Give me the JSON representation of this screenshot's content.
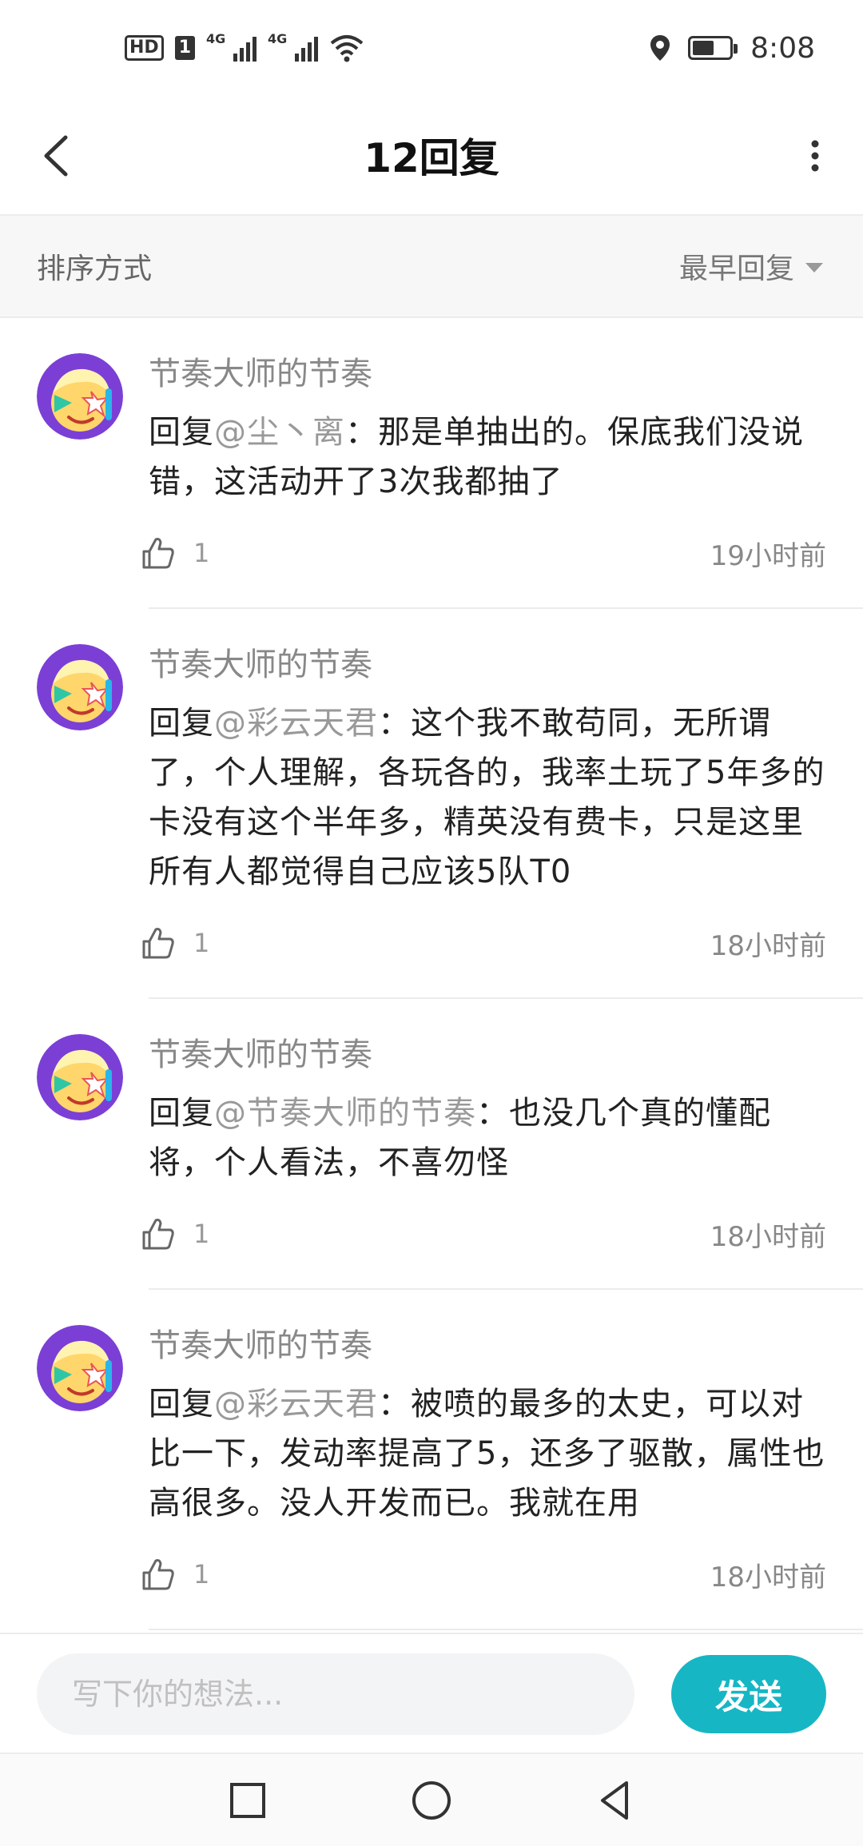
{
  "status_bar": {
    "hd": "HD",
    "sim": "1",
    "net1": "4G",
    "net2": "4G",
    "time": "8:08"
  },
  "header": {
    "title": "12回复"
  },
  "sort_bar": {
    "label": "排序方式",
    "selected": "最早回复"
  },
  "replies": [
    {
      "author": "节奏大师的节奏",
      "prefix": "回复",
      "mention": "@尘丶离",
      "text": "：那是单抽出的。保底我们没说错，这活动开了3次我都抽了",
      "likes": "1",
      "time": "19小时前"
    },
    {
      "author": "节奏大师的节奏",
      "prefix": "回复",
      "mention": "@彩云天君",
      "text": "：这个我不敢苟同，无所谓了，个人理解，各玩各的，我率土玩了5年多的卡没有这个半年多，精英没有费卡，只是这里所有人都觉得自己应该5队T0",
      "likes": "1",
      "time": "18小时前"
    },
    {
      "author": "节奏大师的节奏",
      "prefix": "回复",
      "mention": "@节奏大师的节奏",
      "text": "：也没几个真的懂配将，个人看法，不喜勿怪",
      "likes": "1",
      "time": "18小时前"
    },
    {
      "author": "节奏大师的节奏",
      "prefix": "回复",
      "mention": "@彩云天君",
      "text": "：被喷的最多的太史，可以对比一下，发动率提高了5，还多了驱散，属性也高很多。没人开发而已。我就在用",
      "likes": "1",
      "time": "18小时前"
    }
  ],
  "input_bar": {
    "placeholder": "写下你的想法...",
    "send_label": "发送"
  },
  "colors": {
    "accent": "#17b6c4",
    "avatar_bg": "#7b3fd6"
  },
  "icons": {
    "back": "back-arrow-icon",
    "more": "more-vertical-icon",
    "like": "thumbs-up-icon",
    "nav_recent": "square-icon",
    "nav_home": "circle-icon",
    "nav_back": "triangle-back-icon"
  }
}
